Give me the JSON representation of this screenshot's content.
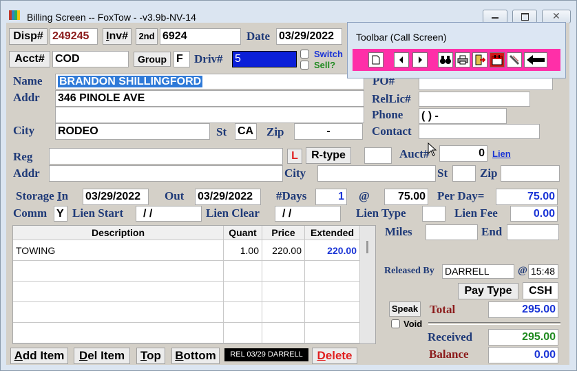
{
  "window": {
    "title": "Billing Screen -- FoxTow - -v3.9b-NV-14"
  },
  "toolbar": {
    "title": "Toolbar (Call Screen)"
  },
  "header": {
    "disp_label": "Disp#",
    "disp_value": "249245",
    "inv_label": "Inv#",
    "second_label": "2nd",
    "inv_value": "6924",
    "date_label": "Date",
    "date_value": "03/29/2022",
    "acct_label": "Acct#",
    "acct_value": "COD",
    "group_label": "Group",
    "group_value": "F",
    "driv_label": "Driv#",
    "driv_value": "5",
    "switch_label": "Switch",
    "sell_label": "Sell?"
  },
  "customer": {
    "name_label": "Name",
    "name_value": "BRANDON SHILLINGFORD",
    "addr_label": "Addr",
    "addr_value": "346 PINOLE AVE",
    "addr2_value": "",
    "city_label": "City",
    "city_value": "RODEO",
    "st_label": "St",
    "st_value": "CA",
    "zip_label": "Zip",
    "zip_value": "-",
    "po_label": "PO#",
    "po_value": "",
    "rellic_label": "RelLic#",
    "rellic_value": "",
    "phone_label": "Phone",
    "phone_value": "(  )  -",
    "contact_label": "Contact",
    "contact_value": ""
  },
  "registration": {
    "reg_label": "Reg",
    "reg_value": "",
    "l_label": "L",
    "rtype_label": "R-type",
    "rtype_value": "",
    "auct_label": "Auct#",
    "auct_value": "0",
    "lien_link": "Lien",
    "addr_label": "Addr",
    "addr_value": "",
    "city_label": "City",
    "city_value": "",
    "st_label": "St",
    "st_value": "",
    "zip_label": "Zip",
    "zip_value": ""
  },
  "storage": {
    "in_label": "Storage In",
    "in_value": "03/29/2022",
    "out_label": "Out",
    "out_value": "03/29/2022",
    "days_label": "#Days",
    "days_value": "1",
    "at_label": "@",
    "rate_value": "75.00",
    "perday_label": "Per Day=",
    "perday_value": "75.00",
    "comm_label": "Comm",
    "comm_value": "Y",
    "lienstart_label": "Lien Start",
    "lienstart_value": "/ /",
    "lienclear_label": "Lien Clear",
    "lienclear_value": "/ /",
    "lientype_label": "Lien Type",
    "lientype_value": "",
    "lienfee_label": "Lien Fee",
    "lienfee_value": "0.00"
  },
  "items": {
    "columns": [
      "Description",
      "Quant",
      "Price",
      "Extended"
    ],
    "rows": [
      {
        "description": "TOWING",
        "quant": "1.00",
        "price": "220.00",
        "extended": "220.00"
      }
    ]
  },
  "summary": {
    "miles_label": "Miles",
    "miles_value": "",
    "end_label": "End",
    "end_value": "",
    "released_label": "Released By",
    "released_value": "DARRELL",
    "at_label": "@",
    "released_time": "15:48",
    "paytype_label": "Pay Type",
    "paytype_value": "CSH",
    "speak_label": "Speak",
    "void_label": "Void",
    "total_label": "Total",
    "total_value": "295.00",
    "received_label": "Received",
    "received_value": "295.00",
    "balance_label": "Balance",
    "balance_value": "0.00"
  },
  "footer": {
    "add_item": "Add Item",
    "del_item": "Del Item",
    "top": "Top",
    "bottom": "Bottom",
    "release_badge": "REL 03/29 DARRELL",
    "delete": "Delete"
  }
}
